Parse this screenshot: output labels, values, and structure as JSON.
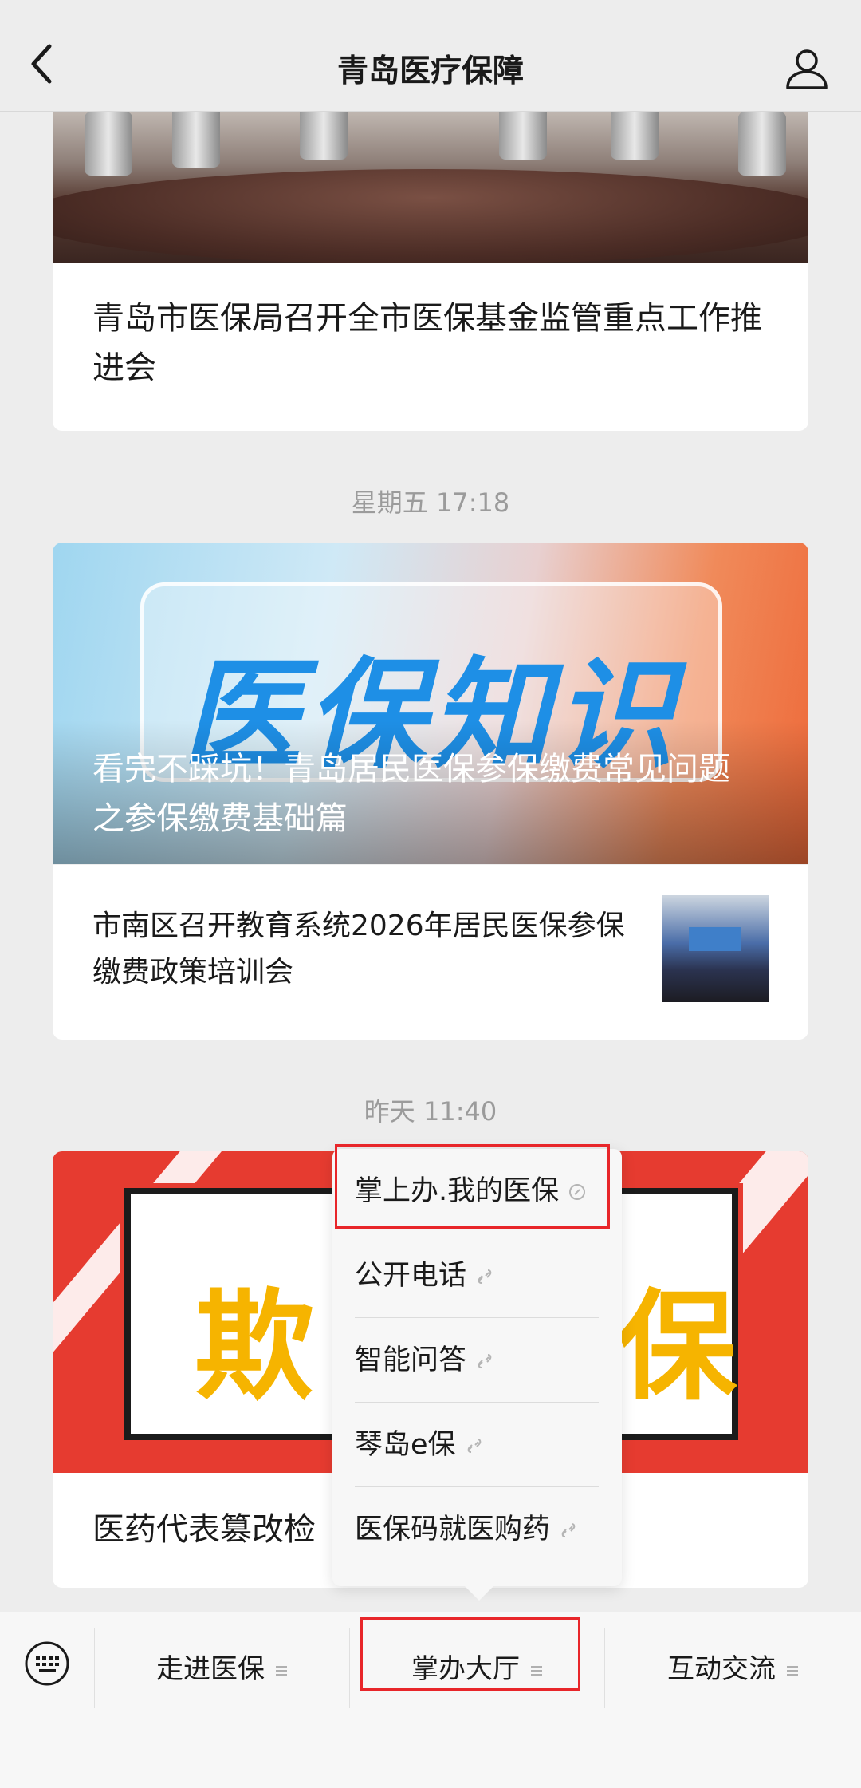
{
  "header": {
    "title": "青岛医疗保障",
    "back_icon": "chevron-left-icon",
    "profile_icon": "person-icon"
  },
  "articles": [
    {
      "title": "青岛市医保局召开全市医保基金监管重点工作推进会"
    },
    {
      "timestamp": "星期五 17:18",
      "cover_text": "医保知识",
      "cover_title": "看完不踩坑！青岛居民医保参保缴费常见问题之参保缴费基础篇",
      "sub_title": "市南区召开教育系统2026年居民医保参保缴费政策培训会"
    },
    {
      "timestamp": "昨天 11:40",
      "cover_text_left": "欺",
      "cover_text_right": "保",
      "title": "医药代表篡改检"
    }
  ],
  "popup_menu": {
    "items": [
      {
        "label": "掌上办.我的医保",
        "icon": "link-icon"
      },
      {
        "label": "公开电话",
        "icon": "link-icon"
      },
      {
        "label": "智能问答",
        "icon": "link-icon"
      },
      {
        "label": "琴岛e保",
        "icon": "link-icon"
      },
      {
        "label": "医保码就医购药",
        "icon": "link-icon"
      }
    ],
    "highlight_color": "#e8262a"
  },
  "bottom_menu": {
    "keyboard_icon": "keyboard-icon",
    "menus": [
      {
        "label": "走进医保",
        "icon": "menu-icon"
      },
      {
        "label": "掌办大厅",
        "icon": "menu-icon"
      },
      {
        "label": "互动交流",
        "icon": "menu-icon"
      }
    ]
  }
}
